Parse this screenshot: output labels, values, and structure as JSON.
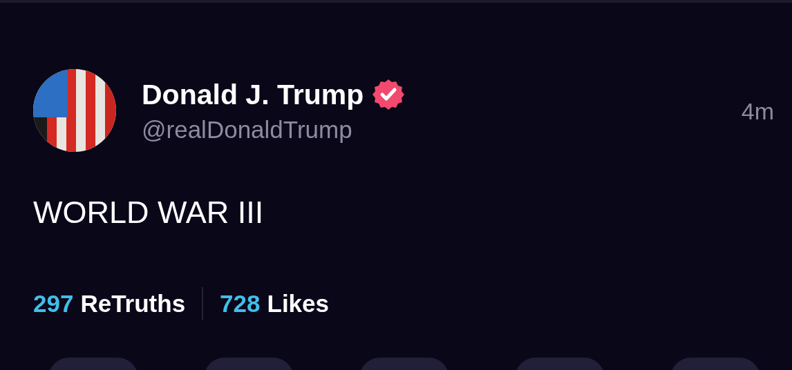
{
  "post": {
    "author": {
      "name": "Donald J. Trump",
      "verified": true,
      "handle": "@realDonaldTrump"
    },
    "time": "4m",
    "body": "WORLD WAR III",
    "stats": [
      {
        "count": "297",
        "label": "ReTruths"
      },
      {
        "count": "728",
        "label": "Likes"
      }
    ],
    "action_buttons": [
      {
        "kind": "action"
      },
      {
        "kind": "action"
      },
      {
        "kind": "action"
      },
      {
        "kind": "action"
      },
      {
        "kind": "action"
      }
    ]
  }
}
